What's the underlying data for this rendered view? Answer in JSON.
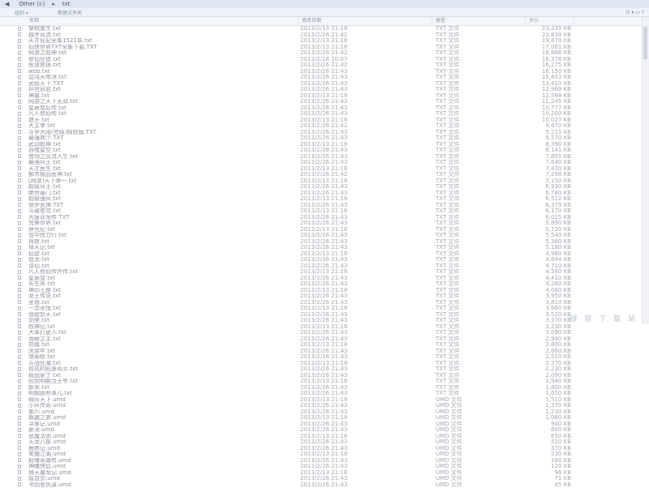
{
  "titlebar": {
    "back": "◀",
    "forward": "▶",
    "path_parts": [
      "Other (I:)",
      "txt"
    ],
    "sep": "▸"
  },
  "toolbar": {
    "organize": "组织",
    "new_folder": "新建文件夹",
    "view_icons": "☷ ▾ ▭ ?"
  },
  "columns": {
    "name": "名称",
    "date": "修改日期",
    "type": "类型",
    "size": "大小"
  },
  "rows": [
    {
      "name": "穿越重生.txt",
      "date": "2013/2/13 21:18",
      "type": "TXT 文件",
      "size": "23,335 KB"
    },
    {
      "name": "独步风流.txt",
      "date": "2013/2/26 21:42",
      "type": "TXT 文件",
      "size": "22,839 KB"
    },
    {
      "name": "天才狂妃全集1521章.txt",
      "date": "2013/2/13 21:18",
      "type": "TXT 文件",
      "size": "19,870 KB"
    },
    {
      "name": "仙侠世界TXT全集下载.TXT",
      "date": "2013/2/13 21:18",
      "type": "TXT 文件",
      "size": "17,081 KB"
    },
    {
      "name": "网游之超神.txt",
      "date": "2013/2/26 21:42",
      "type": "TXT 文件",
      "size": "16,888 KB"
    },
    {
      "name": "修仙狂徒.txt",
      "date": "2013/2/26 10:07",
      "type": "TXT 文件",
      "size": "16,378 KB"
    },
    {
      "name": "医道官途.txt",
      "date": "2013/2/26 21:42",
      "type": "TXT 文件",
      "size": "16,275 KB"
    },
    {
      "name": "wbb.txt",
      "date": "2013/2/26 21:43",
      "type": "TXT 文件",
      "size": "16,150 KB"
    },
    {
      "name": "混沌天帝决.txt",
      "date": "2013/2/26 21:43",
      "type": "TXT 文件",
      "size": "15,833 KB"
    },
    {
      "name": "武极天下.TXT",
      "date": "2013/2/26 21:43",
      "type": "TXT 文件",
      "size": "13,410 KB"
    },
    {
      "name": "异世邪君.txt",
      "date": "2013/2/26 21:43",
      "type": "TXT 文件",
      "size": "12,969 KB"
    },
    {
      "name": "神墓.txt",
      "date": "2013/2/13 21:18",
      "type": "TXT 文件",
      "size": "12,588 KB"
    },
    {
      "name": "网游之天下无双.txt",
      "date": "2013/2/26 21:43",
      "type": "TXT 文件",
      "size": "11,245 KB"
    },
    {
      "name": "星辰变后传.txt",
      "date": "2013/2/26 21:43",
      "type": "TXT 文件",
      "size": "10,777 KB"
    },
    {
      "name": "凡人修仙传.txt",
      "date": "2013/2/26 21:43",
      "type": "TXT 文件",
      "size": "10,200 KB"
    },
    {
      "name": "遮天.txt",
      "date": "2013/2/13 21:18",
      "type": "TXT 文件",
      "size": "10,027 KB"
    },
    {
      "name": "大主宰.txt",
      "date": "2013/2/26 21:42",
      "type": "TXT 文件",
      "size": "9,870 KB"
    },
    {
      "name": "斗罗大陆(完结)精校版.TXT",
      "date": "2013/2/26 21:43",
      "type": "TXT 文件",
      "size": "9,215 KB"
    },
    {
      "name": "最强弃少.TXT",
      "date": "2013/2/26 21:43",
      "type": "TXT 文件",
      "size": "8,570 KB"
    },
    {
      "name": "武动乾坤.txt",
      "date": "2013/2/13 21:18",
      "type": "TXT 文件",
      "size": "8,390 KB"
    },
    {
      "name": "吞噬星空.txt",
      "date": "2013/2/26 21:43",
      "type": "TXT 文件",
      "size": "8,141 KB"
    },
    {
      "name": "官场之风流人生.txt",
      "date": "2013/2/26 21:43",
      "type": "TXT 文件",
      "size": "7,855 KB"
    },
    {
      "name": "最强兵王.txt",
      "date": "2013/2/26 21:43",
      "type": "TXT 文件",
      "size": "7,640 KB"
    },
    {
      "name": "天才医生.txt",
      "date": "2013/2/13 21:18",
      "type": "TXT 文件",
      "size": "7,430 KB"
    },
    {
      "name": "都市极品医神.txt",
      "date": "2013/2/26 21:42",
      "type": "TXT 文件",
      "size": "7,298 KB"
    },
    {
      "name": "[网游]天下第一.txt",
      "date": "2013/2/13 21:18",
      "type": "TXT 文件",
      "size": "7,150 KB"
    },
    {
      "name": "超级兵王.txt",
      "date": "2013/2/26 21:43",
      "type": "TXT 文件",
      "size": "6,930 KB"
    },
    {
      "name": "绝世唐门.txt",
      "date": "2013/2/26 21:43",
      "type": "TXT 文件",
      "size": "6,780 KB"
    },
    {
      "name": "超级强兵.txt",
      "date": "2013/2/13 21:18",
      "type": "TXT 文件",
      "size": "6,512 KB"
    },
    {
      "name": "修罗武神.TXT",
      "date": "2013/2/26 21:43",
      "type": "TXT 文件",
      "size": "6,379 KB"
    },
    {
      "name": "斗破苍穹.txt",
      "date": "2013/2/13 21:18",
      "type": "TXT 文件",
      "size": "6,170 KB"
    },
    {
      "name": "大唐双龙传.TXT",
      "date": "2013/2/26 21:43",
      "type": "TXT 文件",
      "size": "6,015 KB"
    },
    {
      "name": "完美世界.txt",
      "date": "2013/2/26 21:43",
      "type": "TXT 文件",
      "size": "5,890 KB"
    },
    {
      "name": "莽荒纪.txt",
      "date": "2013/2/13 21:18",
      "type": "TXT 文件",
      "size": "5,720 KB"
    },
    {
      "name": "雪中悍刀行.txt",
      "date": "2013/2/26 21:43",
      "type": "TXT 文件",
      "size": "5,540 KB"
    },
    {
      "name": "将夜.txt",
      "date": "2013/2/26 21:43",
      "type": "TXT 文件",
      "size": "5,360 KB"
    },
    {
      "name": "择天记.txt",
      "date": "2013/2/26 21:43",
      "type": "TXT 文件",
      "size": "5,180 KB"
    },
    {
      "name": "仙逆.txt",
      "date": "2013/2/13 21:18",
      "type": "TXT 文件",
      "size": "4,980 KB"
    },
    {
      "name": "盘龙.txt",
      "date": "2013/2/26 21:43",
      "type": "TXT 文件",
      "size": "4,844 KB"
    },
    {
      "name": "诛仙.txt",
      "date": "2013/2/26 21:43",
      "type": "TXT 文件",
      "size": "4,710 KB"
    },
    {
      "name": "凡人修仙传外传.txt",
      "date": "2013/2/13 21:18",
      "type": "TXT 文件",
      "size": "4,560 KB"
    },
    {
      "name": "星辰变.txt",
      "date": "2013/2/26 21:43",
      "type": "TXT 文件",
      "size": "4,410 KB"
    },
    {
      "name": "长生界.txt",
      "date": "2013/2/26 21:43",
      "type": "TXT 文件",
      "size": "4,260 KB"
    },
    {
      "name": "神印王座.txt",
      "date": "2013/2/13 21:18",
      "type": "TXT 文件",
      "size": "4,080 KB"
    },
    {
      "name": "龙王传说.txt",
      "date": "2013/2/26 21:43",
      "type": "TXT 文件",
      "size": "3,950 KB"
    },
    {
      "name": "圣墟.txt",
      "date": "2013/2/26 21:43",
      "type": "TXT 文件",
      "size": "3,810 KB"
    },
    {
      "name": "一念永恒.txt",
      "date": "2013/2/13 21:18",
      "type": "TXT 文件",
      "size": "3,660 KB"
    },
    {
      "name": "我欲封天.txt",
      "date": "2013/2/26 21:43",
      "type": "TXT 文件",
      "size": "3,520 KB"
    },
    {
      "name": "剑来.txt",
      "date": "2013/2/26 21:43",
      "type": "TXT 文件",
      "size": "3,370 KB"
    },
    {
      "name": "牧神记.txt",
      "date": "2013/2/13 21:18",
      "type": "TXT 文件",
      "size": "3,230 KB"
    },
    {
      "name": "大奉打更人.txt",
      "date": "2013/2/26 21:43",
      "type": "TXT 文件",
      "size": "3,090 KB"
    },
    {
      "name": "诡秘之主.txt",
      "date": "2013/2/26 21:43",
      "type": "TXT 文件",
      "size": "2,940 KB"
    },
    {
      "name": "赘婿.txt",
      "date": "2013/2/13 21:18",
      "type": "TXT 文件",
      "size": "2,800 KB"
    },
    {
      "name": "庆余年.txt",
      "date": "2013/2/26 21:43",
      "type": "TXT 文件",
      "size": "2,660 KB"
    },
    {
      "name": "琅琊榜.txt",
      "date": "2013/2/26 21:43",
      "type": "TXT 文件",
      "size": "2,510 KB"
    },
    {
      "name": "斗战狂潮.txt",
      "date": "2013/2/13 21:18",
      "type": "TXT 文件",
      "size": "2,370 KB"
    },
    {
      "name": "校花的贴身高手.txt",
      "date": "2013/2/26 21:43",
      "type": "TXT 文件",
      "size": "2,230 KB"
    },
    {
      "name": "极品家丁.txt",
      "date": "2013/2/26 21:43",
      "type": "TXT 文件",
      "size": "2,080 KB"
    },
    {
      "name": "回到明朝当王爷.txt",
      "date": "2013/2/13 21:18",
      "type": "TXT 文件",
      "size": "1,940 KB"
    },
    {
      "name": "新宋.txt",
      "date": "2013/2/26 21:43",
      "type": "TXT 文件",
      "size": "1,800 KB"
    },
    {
      "name": "明朝那些事儿.txt",
      "date": "2013/2/26 21:43",
      "type": "TXT 文件",
      "size": "1,650 KB"
    },
    {
      "name": "佣兵天下.umd",
      "date": "2013/2/13 21:18",
      "type": "UMD 文件",
      "size": "1,510 KB"
    },
    {
      "name": "小兵传奇.umd",
      "date": "2013/2/26 21:43",
      "type": "UMD 文件",
      "size": "1,370 KB"
    },
    {
      "name": "紫川.umd",
      "date": "2013/2/26 21:43",
      "type": "UMD 文件",
      "size": "1,230 KB"
    },
    {
      "name": "飘邈之旅.umd",
      "date": "2013/2/13 21:18",
      "type": "UMD 文件",
      "size": "1,080 KB"
    },
    {
      "name": "寻秦记.umd",
      "date": "2013/2/26 21:43",
      "type": "UMD 文件",
      "size": "940 KB"
    },
    {
      "name": "亵渎.umd",
      "date": "2013/2/26 21:43",
      "type": "UMD 文件",
      "size": "800 KB"
    },
    {
      "name": "恶魔法则.umd",
      "date": "2013/2/13 21:18",
      "type": "UMD 文件",
      "size": "650 KB"
    },
    {
      "name": "天龙八部.umd",
      "date": "2013/2/26 21:43",
      "type": "UMD 文件",
      "size": "510 KB"
    },
    {
      "name": "鹿鼎记.umd",
      "date": "2013/2/26 21:43",
      "type": "UMD 文件",
      "size": "370 KB"
    },
    {
      "name": "笑傲江湖.umd",
      "date": "2013/2/13 21:18",
      "type": "UMD 文件",
      "size": "230 KB"
    },
    {
      "name": "射雕英雄传.umd",
      "date": "2013/2/26 21:43",
      "type": "UMD 文件",
      "size": "160 KB"
    },
    {
      "name": "神雕侠侣.umd",
      "date": "2013/2/26 21:43",
      "type": "UMD 文件",
      "size": "120 KB"
    },
    {
      "name": "倚天屠龙记.umd",
      "date": "2013/2/13 21:18",
      "type": "UMD 文件",
      "size": "98 KB"
    },
    {
      "name": "碧血剑.umd",
      "date": "2013/2/26 21:43",
      "type": "UMD 文件",
      "size": "71 KB"
    },
    {
      "name": "书剑恩仇录.umd",
      "date": "2013/2/26 21:43",
      "type": "UMD 文件",
      "size": "45 KB"
    }
  ],
  "watermark": "绿 软 下 载 站"
}
